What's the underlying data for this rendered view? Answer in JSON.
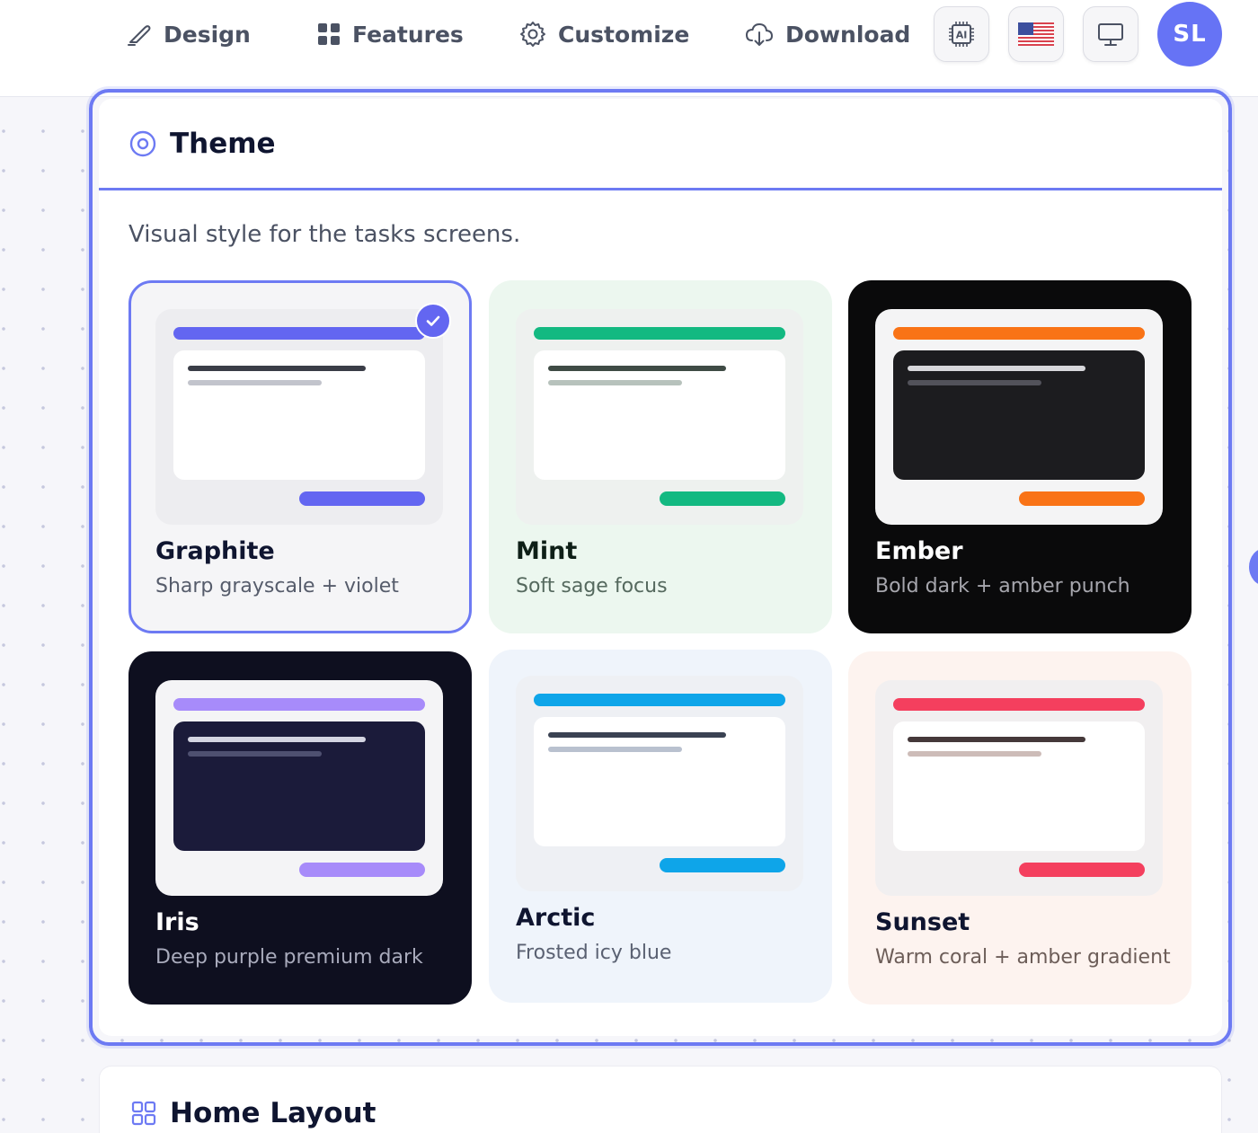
{
  "nav": {
    "design": "Design",
    "features": "Features",
    "customize": "Customize",
    "download": "Download",
    "ai_icon": "AI",
    "avatar_initials": "SL"
  },
  "theme_panel": {
    "title": "Theme",
    "description": "Visual style for the tasks screens.",
    "selected": "Graphite",
    "themes": [
      {
        "name": "Graphite",
        "description": "Sharp grayscale + violet",
        "accent": "#6366f1",
        "background": "#f5f5f7"
      },
      {
        "name": "Mint",
        "description": "Soft sage focus",
        "accent": "#13b981",
        "background": "#ecf7ef"
      },
      {
        "name": "Ember",
        "description": "Bold dark + amber punch",
        "accent": "#f97316",
        "background": "#0a0a0b"
      },
      {
        "name": "Iris",
        "description": "Deep purple premium dark",
        "accent": "#a78bfa",
        "background": "#0e0f1f"
      },
      {
        "name": "Arctic",
        "description": "Frosted icy blue",
        "accent": "#0ea5e9",
        "background": "#eff4fb"
      },
      {
        "name": "Sunset",
        "description": "Warm coral + amber gradient",
        "accent": "#f43f5e",
        "background": "#fdf3ef"
      }
    ]
  },
  "layout_panel": {
    "title": "Home Layout"
  },
  "colors": {
    "brand": "#6d7af3",
    "avatar": "#6673f5"
  }
}
